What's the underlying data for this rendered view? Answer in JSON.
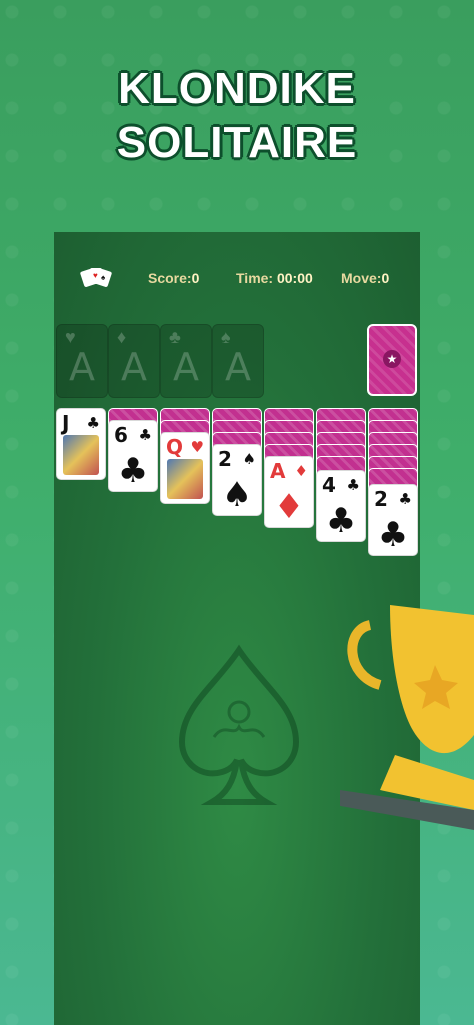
{
  "promo": {
    "title_line1": "KLONDIKE",
    "title_line2": "SOLITAIRE"
  },
  "topbar": {
    "score_label": "Score:",
    "score_value": "0",
    "time_label": "Time:",
    "time_value": "00:00",
    "move_label": "Move:",
    "move_value": "0"
  },
  "foundations": [
    {
      "suit": "♥",
      "letter": "A"
    },
    {
      "suit": "♦",
      "letter": "A"
    },
    {
      "suit": "♣",
      "letter": "A"
    },
    {
      "suit": "♠",
      "letter": "A"
    }
  ],
  "tableau": [
    {
      "face_rank": "J",
      "face_suit": "♣",
      "color": "black"
    },
    {
      "face_rank": "6",
      "face_suit": "♣",
      "color": "black"
    },
    {
      "face_rank": "Q",
      "face_suit": "♥",
      "color": "red"
    },
    {
      "face_rank": "2",
      "face_suit": "♠",
      "color": "black"
    },
    {
      "face_rank": "A",
      "face_suit": "♦",
      "color": "red"
    },
    {
      "face_rank": "4",
      "face_suit": "♣",
      "color": "black"
    },
    {
      "face_rank": "2",
      "face_suit": "♣",
      "color": "black"
    }
  ],
  "colors": {
    "table_green": "#23703a",
    "card_back": "#c23090",
    "accent_gold": "#f2c230"
  },
  "icons": [
    "cards-icon",
    "star-icon",
    "spade-emblem-icon",
    "trophy-icon"
  ]
}
